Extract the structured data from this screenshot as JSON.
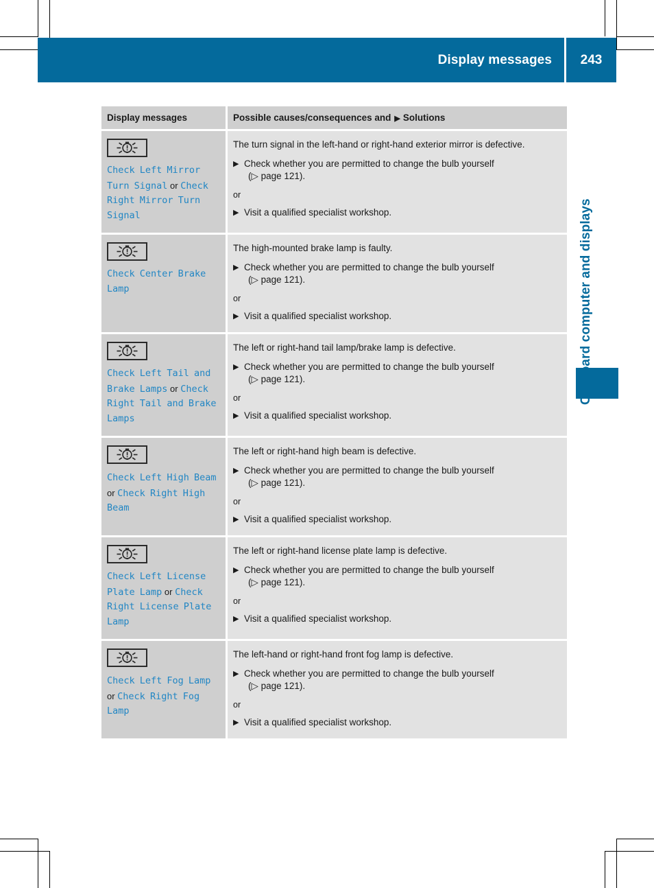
{
  "header": {
    "title": "Display messages",
    "page_number": "243",
    "accent_color": "#046a9c"
  },
  "chapter_tab": {
    "label": "On-board computer and displays",
    "marker_color": "#046a9c"
  },
  "table": {
    "columns": {
      "messages": "Display messages",
      "solutions_prefix": "Possible causes/consequences and",
      "solutions_bullet": "▶",
      "solutions_suffix": "Solutions"
    },
    "rows": [
      {
        "icon": "bulb-warning-icon",
        "message_parts": [
          {
            "type": "code",
            "text": "Check Left Mirror Turn Signal"
          },
          {
            "type": "plain",
            "text": "or"
          },
          {
            "type": "code",
            "text": "Check Right Mirror Turn Signal"
          }
        ],
        "cause": "The turn signal in the left-hand or right-hand exterior mirror is defective.",
        "step1": "Check whether you are permitted to change the bulb yourself",
        "step1_ref": "(▷ page 121).",
        "or": "or",
        "step2": "Visit a qualified specialist workshop."
      },
      {
        "icon": "bulb-warning-icon",
        "message_parts": [
          {
            "type": "code",
            "text": "Check Center Brake Lamp"
          }
        ],
        "cause": "The high-mounted brake lamp is faulty.",
        "step1": "Check whether you are permitted to change the bulb yourself",
        "step1_ref": "(▷ page 121).",
        "or": "or",
        "step2": "Visit a qualified specialist workshop."
      },
      {
        "icon": "bulb-warning-icon",
        "message_parts": [
          {
            "type": "code",
            "text": "Check Left Tail and Brake Lamps"
          },
          {
            "type": "plain",
            "text": "or"
          },
          {
            "type": "code",
            "text": "Check Right Tail and Brake Lamps"
          }
        ],
        "cause": "The left or right-hand tail lamp/brake lamp is defective.",
        "step1": "Check whether you are permitted to change the bulb yourself",
        "step1_ref": "(▷ page 121).",
        "or": "or",
        "step2": "Visit a qualified specialist workshop."
      },
      {
        "icon": "bulb-warning-icon",
        "message_parts": [
          {
            "type": "code",
            "text": "Check Left High Beam"
          },
          {
            "type": "plain",
            "text": "or"
          },
          {
            "type": "code",
            "text": "Check Right High Beam"
          }
        ],
        "cause": "The left or right-hand high beam is defective.",
        "step1": "Check whether you are permitted to change the bulb yourself",
        "step1_ref": "(▷ page 121).",
        "or": "or",
        "step2": "Visit a qualified specialist workshop."
      },
      {
        "icon": "bulb-warning-icon",
        "message_parts": [
          {
            "type": "code",
            "text": "Check Left License Plate Lamp"
          },
          {
            "type": "plain",
            "text": "or"
          },
          {
            "type": "code",
            "text": "Check Right License Plate Lamp"
          }
        ],
        "cause": "The left or right-hand license plate lamp is defective.",
        "step1": "Check whether you are permitted to change the bulb yourself",
        "step1_ref": "(▷ page 121).",
        "or": "or",
        "step2": "Visit a qualified specialist workshop."
      },
      {
        "icon": "bulb-warning-icon",
        "message_parts": [
          {
            "type": "code",
            "text": "Check Left Fog Lamp"
          },
          {
            "type": "plain",
            "text": "or"
          },
          {
            "type": "code",
            "text": "Check Right Fog Lamp"
          }
        ],
        "cause": "The left-hand or right-hand front fog lamp is defective.",
        "step1": "Check whether you are permitted to change the bulb yourself",
        "step1_ref": "(▷ page 121).",
        "or": "or",
        "step2": "Visit a qualified specialist workshop."
      }
    ]
  }
}
